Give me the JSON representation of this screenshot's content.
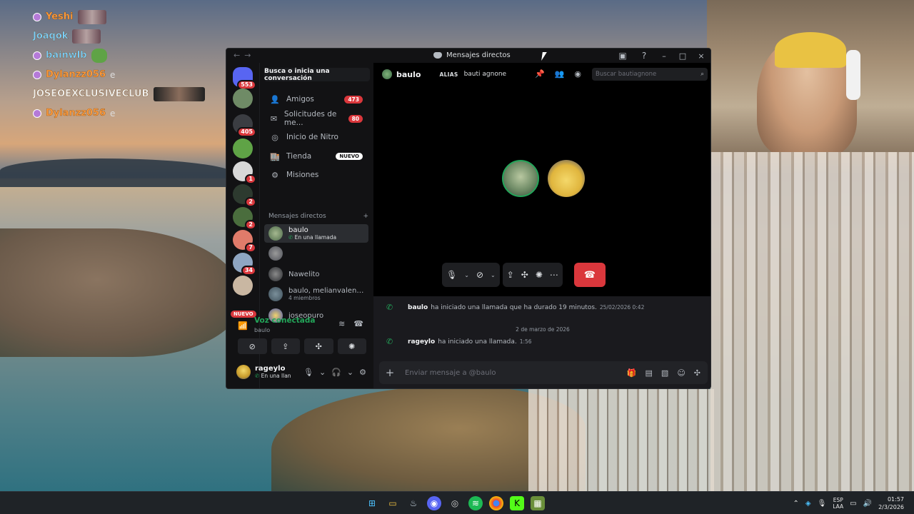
{
  "overlay_chat": [
    {
      "name": "Yeshi",
      "text": "",
      "style": "orange"
    },
    {
      "name": "Joaqok",
      "text": "",
      "style": "blue"
    },
    {
      "name": "bainwlb",
      "text": "",
      "style": "blue"
    },
    {
      "name": "Dylanzz056",
      "text": "e",
      "style": "orange"
    },
    {
      "name": "JOSEOEXCLUSIVECLUB",
      "text": "",
      "style": "white"
    },
    {
      "name": "Dylanzz056",
      "text": "e",
      "style": "orange"
    }
  ],
  "window": {
    "title": "Mensajes directos"
  },
  "rail": {
    "servers": [
      {
        "badge": "553",
        "color": "#5865f2"
      },
      {
        "badge": "",
        "color": "#6f8b66"
      },
      {
        "badge": "405",
        "color": "#3b3d42"
      },
      {
        "badge": "",
        "color": "#5fa346"
      },
      {
        "badge": "1",
        "color": "#d8d8d8"
      },
      {
        "badge": "2",
        "color": "#2d3a2f"
      },
      {
        "badge": "2",
        "color": "#4a6d3d"
      },
      {
        "badge": "7",
        "color": "#e07b6a"
      },
      {
        "badge": "34",
        "color": "#8fa6c2"
      },
      {
        "badge": "",
        "color": "#c9b7a2"
      }
    ],
    "new_label": "NUEVO"
  },
  "sidebar": {
    "search_label": "Busca o inicia una conversación",
    "nav": [
      {
        "label": "Amigos",
        "count": "473",
        "icon": "friends-icon",
        "glyph": "👤",
        "tag": ""
      },
      {
        "label": "Solicitudes de me...",
        "count": "80",
        "icon": "envelope-icon",
        "glyph": "✉",
        "tag": ""
      },
      {
        "label": "Inicio de Nitro",
        "count": "",
        "icon": "nitro-icon",
        "glyph": "◎",
        "tag": ""
      },
      {
        "label": "Tienda",
        "count": "",
        "icon": "shop-icon",
        "glyph": "🏬",
        "tag": "NUEVO"
      },
      {
        "label": "Misiones",
        "count": "",
        "icon": "quests-icon",
        "glyph": "⚙",
        "tag": ""
      }
    ],
    "dm_header": "Mensajes directos",
    "dms": [
      {
        "name": "baulo",
        "sub": "En una llamada",
        "active": true,
        "color": "#6f8b66"
      },
      {
        "name": "",
        "sub": "",
        "active": false,
        "color": "#6d6f78"
      },
      {
        "name": "Nawelito",
        "sub": "",
        "active": false,
        "color": "#4e5058"
      },
      {
        "name": "baulo, melianvalen, m...",
        "sub": "4 miembros",
        "active": false,
        "color": "#5a6d7a"
      },
      {
        "name": "joseopuro",
        "sub": "",
        "active": false,
        "color": "#d9b84a"
      }
    ],
    "voice": {
      "status": "Voz conectada",
      "channel": "baulo"
    },
    "user": {
      "name": "rageylo",
      "status": "En una llan"
    }
  },
  "main": {
    "header": {
      "name": "baulo",
      "alias_label": "ALIAS",
      "alias_value": "bauti agnone",
      "search_placeholder": "Buscar bautiagnone"
    },
    "messages": [
      {
        "who": "baulo",
        "text": "ha iniciado una llamada que ha durado 19 minutos.",
        "ts": "25/02/2026 0:42"
      },
      {
        "who": "rageylo",
        "text": "ha iniciado una llamada.",
        "ts": "1:56"
      }
    ],
    "date_divider": "2 de marzo de 2026",
    "composer_placeholder": "Enviar mensaje a @baulo"
  },
  "taskbar": {
    "lang_top": "ESP",
    "lang_bottom": "LAA",
    "time": "01:57",
    "date": "2/3/2026"
  }
}
